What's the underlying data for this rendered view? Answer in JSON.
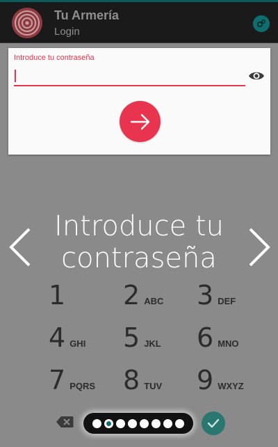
{
  "app": {
    "title": "Tu Armería",
    "subtitle": "Login"
  },
  "login": {
    "label": "Introduce tu contraseña",
    "value": "",
    "placeholder": ""
  },
  "prompt": {
    "line1": "Introduce tu",
    "line2": "contraseña"
  },
  "keypad": [
    {
      "digit": "1",
      "letters": ""
    },
    {
      "digit": "2",
      "letters": "ABC"
    },
    {
      "digit": "3",
      "letters": "DEF"
    },
    {
      "digit": "4",
      "letters": "GHI"
    },
    {
      "digit": "5",
      "letters": "JKL"
    },
    {
      "digit": "6",
      "letters": "MNO"
    },
    {
      "digit": "7",
      "letters": "PQRS"
    },
    {
      "digit": "8",
      "letters": "TUV"
    },
    {
      "digit": "9",
      "letters": "WXYZ"
    }
  ],
  "pin_dots": {
    "total": 8,
    "active_index": 1
  },
  "icons": {
    "logo": "target-icon",
    "settings": "gears-icon",
    "visibility": "eye-icon",
    "submit": "arrow-right-icon",
    "previous": "chevron-left-icon",
    "next": "chevron-right-icon",
    "delete": "backspace-icon",
    "confirm": "check-icon"
  },
  "colors": {
    "accent": "#e8344e",
    "teal": "#0f6e6d",
    "appbar": "#1a1a1a",
    "overlay": "#8a8a8a"
  }
}
